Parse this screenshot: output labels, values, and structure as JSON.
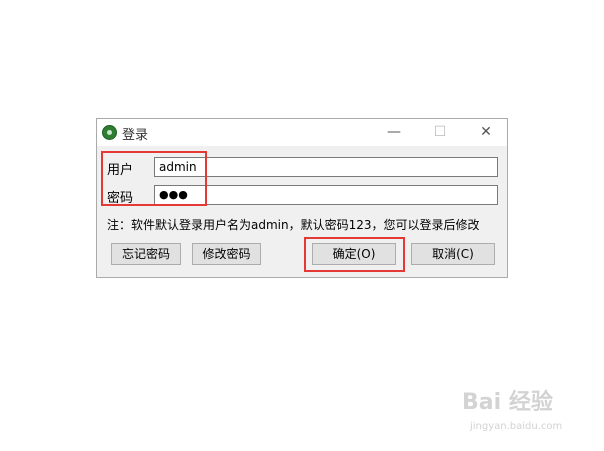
{
  "window": {
    "title": "登录",
    "buttons": {
      "minimize": "—",
      "maximize": "☐",
      "close": "✕"
    }
  },
  "form": {
    "username_label": "用户",
    "username_value": "admin",
    "password_label": "密码",
    "password_value": "●●●",
    "note": "注：软件默认登录用户名为admin，默认密码123，您可以登录后修改"
  },
  "buttons": {
    "forgot": "忘记密码",
    "change": "修改密码",
    "ok": "确定(O)",
    "cancel": "取消(C)"
  },
  "watermark": {
    "brand": "Bai 经验",
    "url": "jingyan.baidu.com"
  },
  "colors": {
    "highlight": "#e53935"
  }
}
